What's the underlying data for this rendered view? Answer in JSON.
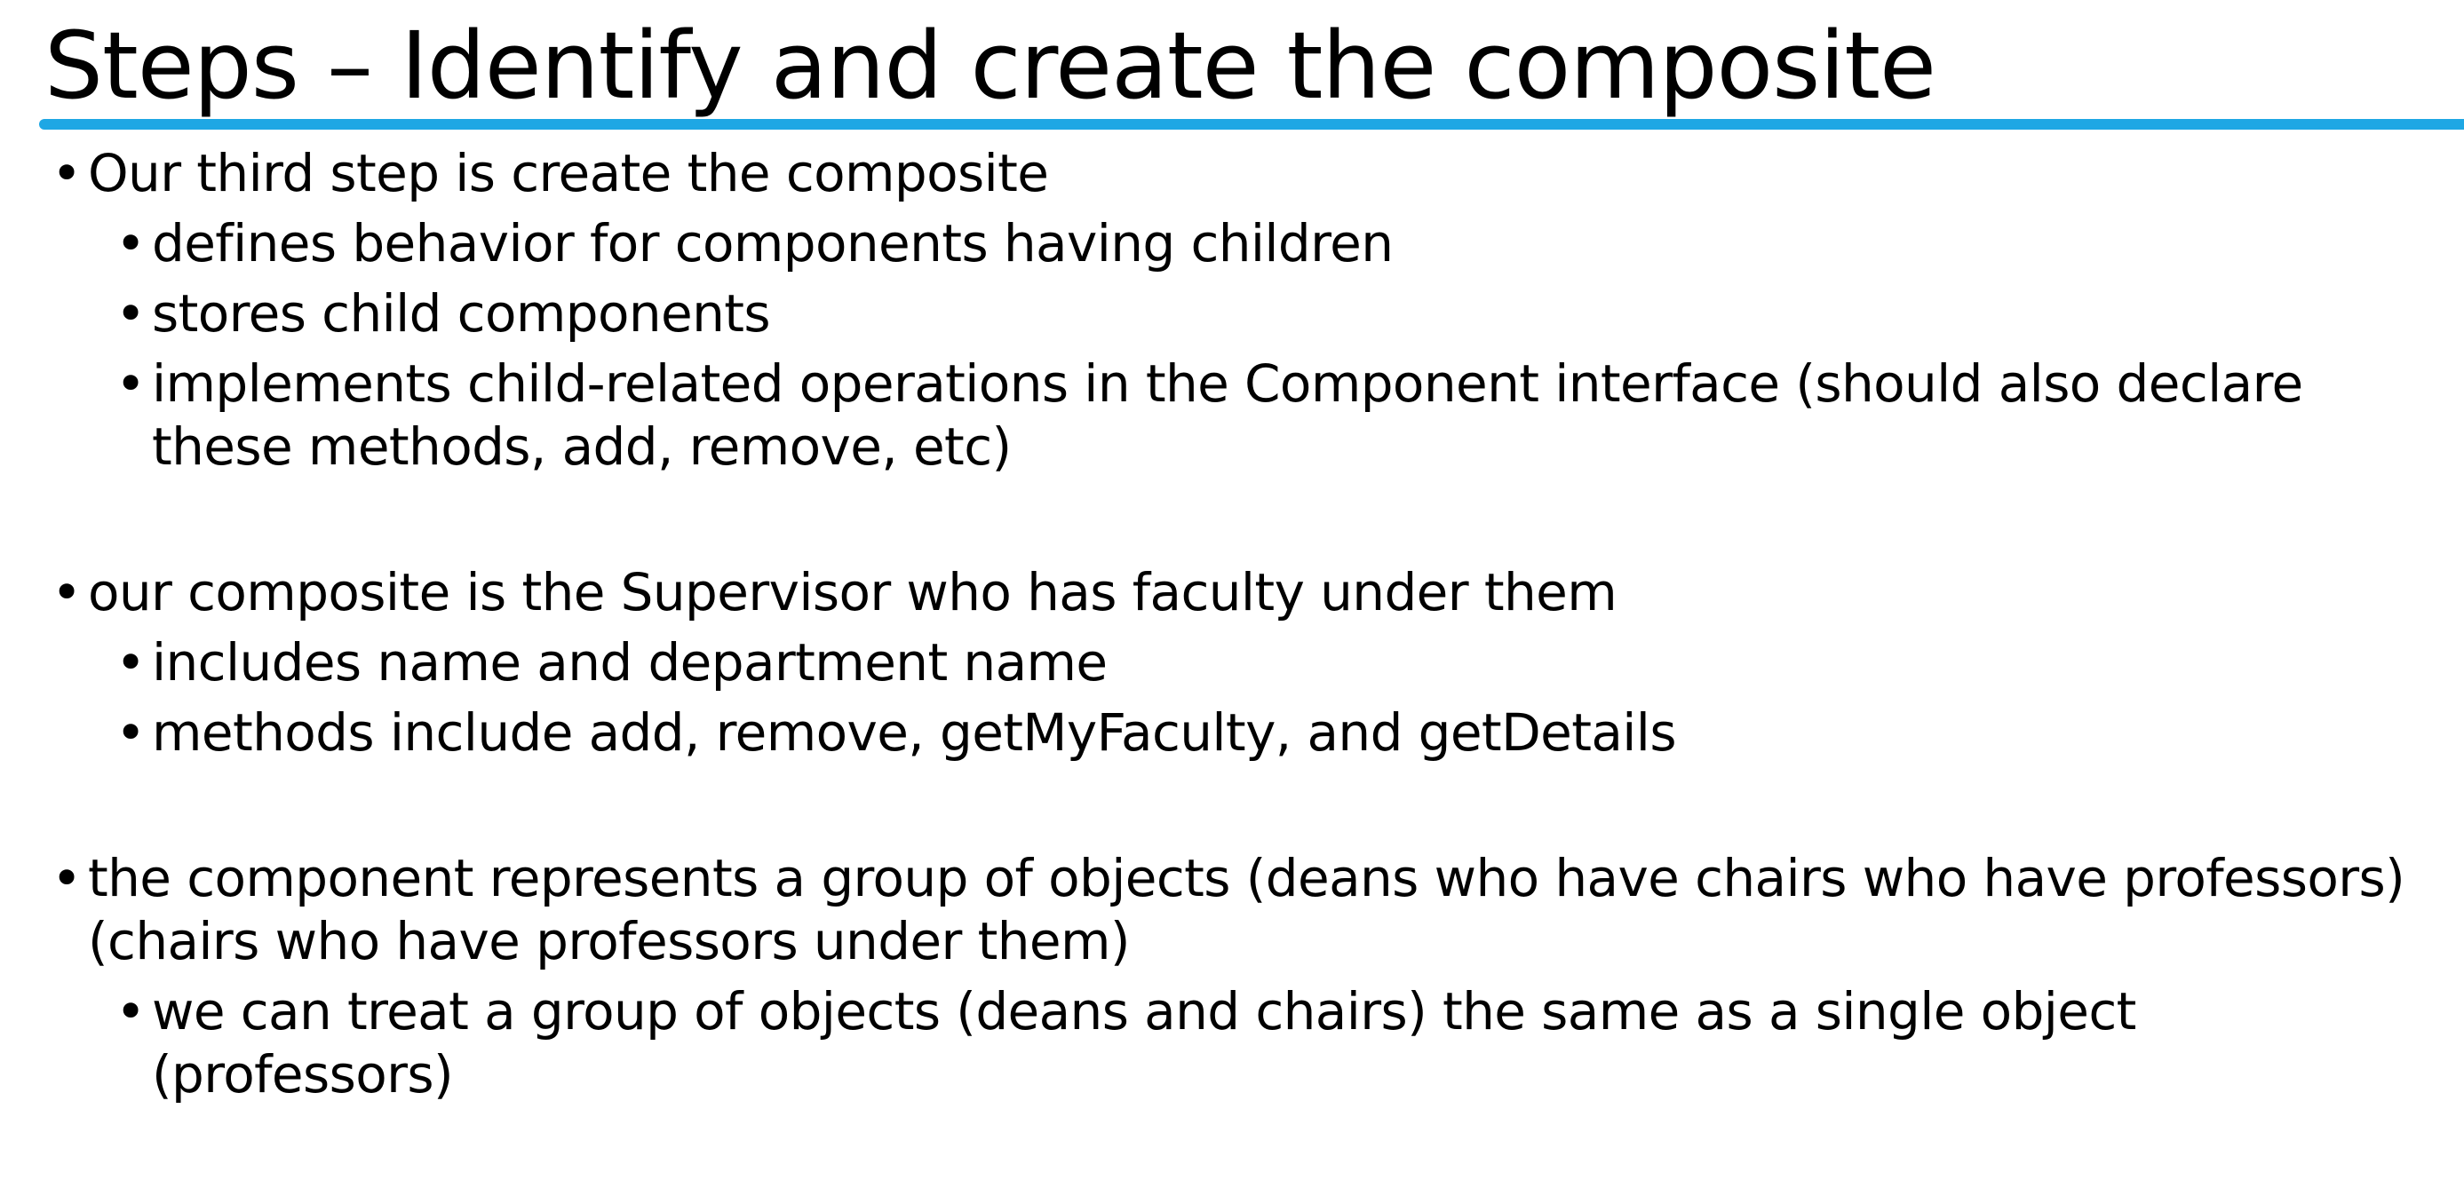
{
  "slide": {
    "title": "Steps – Identify and create the composite",
    "accent_color": "#1ea7e4",
    "bullet_glyph": "•",
    "sections": [
      {
        "main": "Our third step is create the composite",
        "subs": [
          "defines behavior for components having children",
          "stores child components",
          "implements child-related operations in the Component interface (should also declare these methods, add, remove, etc)"
        ]
      },
      {
        "main": "our composite is the Supervisor who has faculty under them",
        "subs": [
          "includes name and department name",
          "methods include add, remove, getMyFaculty, and getDetails"
        ]
      },
      {
        "main": "the component represents a group of objects (deans who have chairs who have professors)(chairs who have professors under them)",
        "subs": [
          "we can treat a group of objects (deans and chairs) the same as a single object (professors)"
        ]
      }
    ]
  }
}
